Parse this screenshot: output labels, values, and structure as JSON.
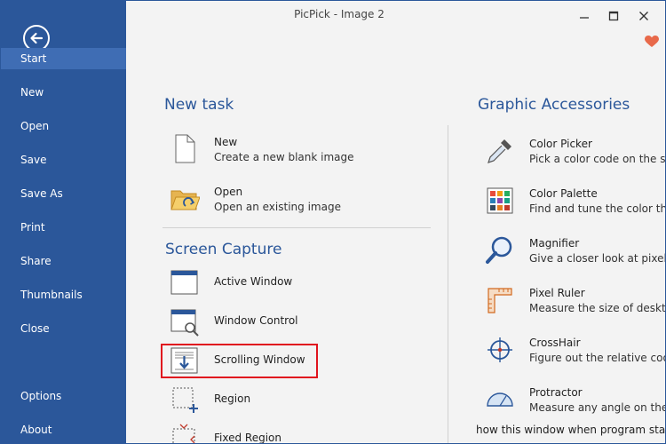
{
  "window": {
    "title": "PicPick - Image 2"
  },
  "sidebar": {
    "items": [
      {
        "label": "Start"
      },
      {
        "label": "New"
      },
      {
        "label": "Open"
      },
      {
        "label": "Save"
      },
      {
        "label": "Save As"
      },
      {
        "label": "Print"
      },
      {
        "label": "Share"
      },
      {
        "label": "Thumbnails"
      },
      {
        "label": "Close"
      },
      {
        "label": "Options"
      },
      {
        "label": "About"
      }
    ]
  },
  "new_task": {
    "heading": "New task",
    "items": [
      {
        "label": "New",
        "desc": "Create a new blank image"
      },
      {
        "label": "Open",
        "desc": "Open an existing image"
      }
    ]
  },
  "screen_capture": {
    "heading": "Screen Capture",
    "items": [
      {
        "label": "Active Window"
      },
      {
        "label": "Window Control"
      },
      {
        "label": "Scrolling Window"
      },
      {
        "label": "Region"
      },
      {
        "label": "Fixed Region"
      }
    ]
  },
  "accessories": {
    "heading": "Graphic Accessories",
    "items": [
      {
        "label": "Color Picker",
        "desc": "Pick a color code on the screen"
      },
      {
        "label": "Color Palette",
        "desc": "Find and tune the color that you want"
      },
      {
        "label": "Magnifier",
        "desc": "Give a closer look at pixels on the screen"
      },
      {
        "label": "Pixel Ruler",
        "desc": "Measure the size of desktop objects"
      },
      {
        "label": "CrossHair",
        "desc": "Figure out the relative coordinates"
      },
      {
        "label": "Protractor",
        "desc": "Measure any angle on the screen"
      }
    ],
    "footer_note": "how this window when program starts"
  },
  "colors": {
    "accent": "#2b579a",
    "highlight": "#e0141e",
    "heart": "#e8694a"
  }
}
